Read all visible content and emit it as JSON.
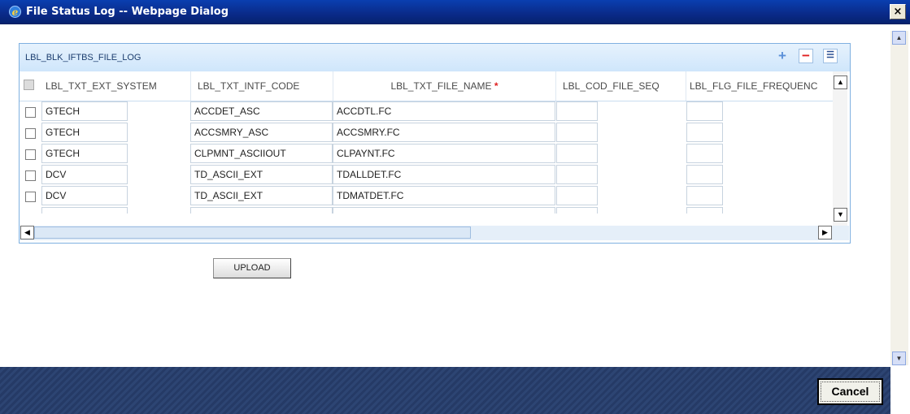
{
  "window": {
    "title": "File Status Log -- Webpage Dialog",
    "close_glyph": "×"
  },
  "panel": {
    "title": "LBL_BLK_IFTBS_FILE_LOG",
    "add_icon": "+",
    "delete_icon": "−",
    "view_icon": "☰"
  },
  "table": {
    "columns": [
      {
        "label": "LBL_TXT_EXT_SYSTEM",
        "required": ""
      },
      {
        "label": "LBL_TXT_INTF_CODE",
        "required": ""
      },
      {
        "label": "LBL_TXT_FILE_NAME",
        "required": "*"
      },
      {
        "label": "LBL_COD_FILE_SEQ",
        "required": ""
      },
      {
        "label": "LBL_FLG_FILE_FREQUENC",
        "required": ""
      }
    ],
    "rows": [
      {
        "ext_system": "GTECH",
        "intf_code": "ACCDET_ASC",
        "file_name": "ACCDTL.FC",
        "file_seq": "",
        "frequency": ""
      },
      {
        "ext_system": "GTECH",
        "intf_code": "ACCSMRY_ASC",
        "file_name": "ACCSMRY.FC",
        "file_seq": "",
        "frequency": ""
      },
      {
        "ext_system": "GTECH",
        "intf_code": "CLPMNT_ASCIIOUT",
        "file_name": "CLPAYNT.FC",
        "file_seq": "",
        "frequency": ""
      },
      {
        "ext_system": "DCV",
        "intf_code": "TD_ASCII_EXT",
        "file_name": "TDALLDET.FC",
        "file_seq": "",
        "frequency": ""
      },
      {
        "ext_system": "DCV",
        "intf_code": "TD_ASCII_EXT",
        "file_name": "TDMATDET.FC",
        "file_seq": "",
        "frequency": ""
      }
    ]
  },
  "buttons": {
    "upload": "UPLOAD",
    "cancel": "Cancel"
  },
  "icons": {
    "scroll_up": "▲",
    "scroll_down": "▼",
    "scroll_left": "◀",
    "scroll_right": "▶",
    "ie_icon": "e"
  }
}
